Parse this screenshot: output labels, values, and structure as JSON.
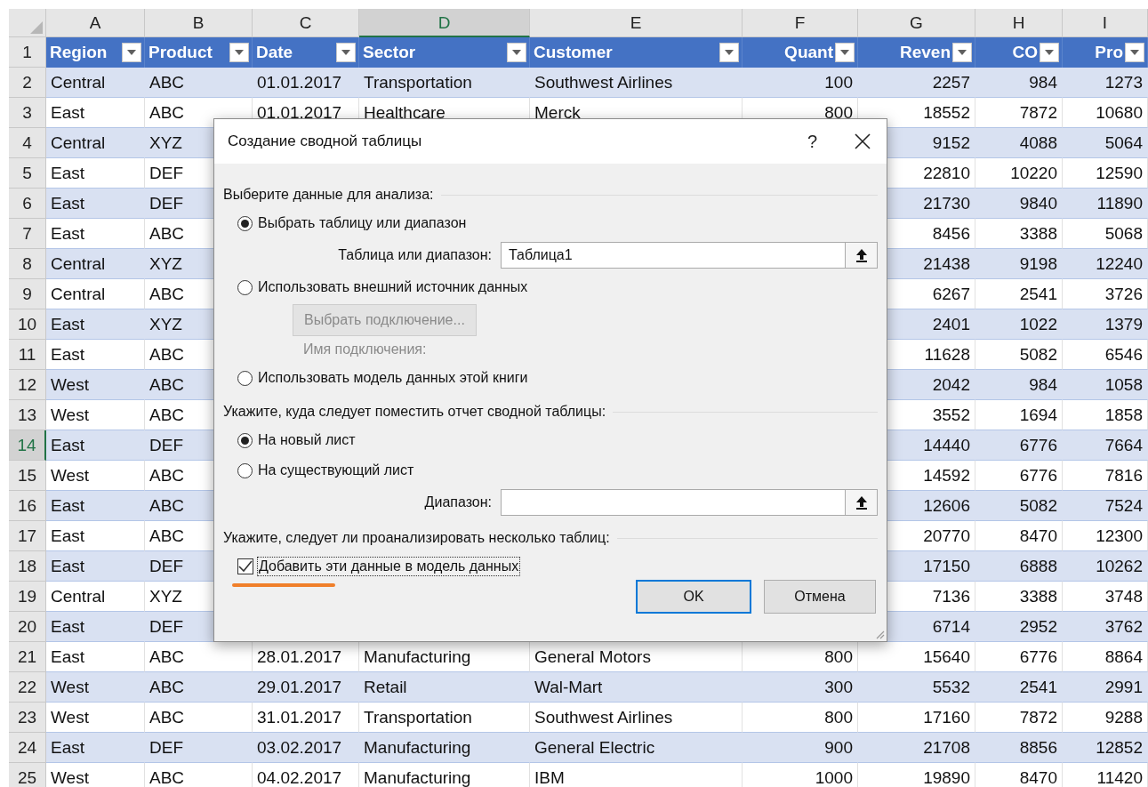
{
  "sheet": {
    "columns": [
      {
        "letter": "A",
        "header": "Region",
        "selected": false
      },
      {
        "letter": "B",
        "header": "Product",
        "selected": false
      },
      {
        "letter": "C",
        "header": "Date",
        "selected": false
      },
      {
        "letter": "D",
        "header": "Sector",
        "selected": true
      },
      {
        "letter": "E",
        "header": "Customer",
        "selected": false
      },
      {
        "letter": "F",
        "header": "Quant",
        "selected": false
      },
      {
        "letter": "G",
        "header": "Reven",
        "selected": false
      },
      {
        "letter": "H",
        "header": "CO",
        "selected": false
      },
      {
        "letter": "I",
        "header": "Pro",
        "selected": false
      }
    ],
    "header_row": "1",
    "rows": [
      {
        "number": "2",
        "selected": false,
        "cells": [
          "Central",
          "ABC",
          "01.01.2017",
          "Transportation",
          "Southwest Airlines",
          "100",
          "2257",
          "984",
          "1273"
        ]
      },
      {
        "number": "3",
        "selected": false,
        "cells": [
          "East",
          "ABC",
          "01.01.2017",
          "Healthcare",
          "Merck",
          "800",
          "18552",
          "7872",
          "10680"
        ]
      },
      {
        "number": "4",
        "selected": false,
        "cells": [
          "Central",
          "XYZ",
          null,
          null,
          null,
          null,
          "9152",
          "4088",
          "5064"
        ]
      },
      {
        "number": "5",
        "selected": false,
        "cells": [
          "East",
          "DEF",
          null,
          null,
          null,
          null,
          "22810",
          "10220",
          "12590"
        ]
      },
      {
        "number": "6",
        "selected": false,
        "cells": [
          "East",
          "DEF",
          null,
          null,
          null,
          null,
          "21730",
          "9840",
          "11890"
        ]
      },
      {
        "number": "7",
        "selected": false,
        "cells": [
          "East",
          "ABC",
          null,
          null,
          null,
          null,
          "8456",
          "3388",
          "5068"
        ]
      },
      {
        "number": "8",
        "selected": false,
        "cells": [
          "Central",
          "XYZ",
          null,
          null,
          null,
          null,
          "21438",
          "9198",
          "12240"
        ]
      },
      {
        "number": "9",
        "selected": false,
        "cells": [
          "Central",
          "ABC",
          null,
          null,
          null,
          null,
          "6267",
          "2541",
          "3726"
        ]
      },
      {
        "number": "10",
        "selected": false,
        "cells": [
          "East",
          "XYZ",
          null,
          null,
          null,
          null,
          "2401",
          "1022",
          "1379"
        ]
      },
      {
        "number": "11",
        "selected": false,
        "cells": [
          "East",
          "ABC",
          null,
          null,
          null,
          null,
          "11628",
          "5082",
          "6546"
        ]
      },
      {
        "number": "12",
        "selected": false,
        "cells": [
          "West",
          "ABC",
          null,
          null,
          null,
          null,
          "2042",
          "984",
          "1058"
        ]
      },
      {
        "number": "13",
        "selected": false,
        "cells": [
          "West",
          "ABC",
          null,
          null,
          null,
          null,
          "3552",
          "1694",
          "1858"
        ]
      },
      {
        "number": "14",
        "selected": true,
        "cells": [
          "East",
          "DEF",
          null,
          null,
          null,
          null,
          "14440",
          "6776",
          "7664"
        ]
      },
      {
        "number": "15",
        "selected": false,
        "cells": [
          "West",
          "ABC",
          null,
          null,
          null,
          null,
          "14592",
          "6776",
          "7816"
        ]
      },
      {
        "number": "16",
        "selected": false,
        "cells": [
          "East",
          "ABC",
          null,
          null,
          null,
          null,
          "12606",
          "5082",
          "7524"
        ]
      },
      {
        "number": "17",
        "selected": false,
        "cells": [
          "East",
          "ABC",
          null,
          null,
          null,
          null,
          "20770",
          "8470",
          "12300"
        ]
      },
      {
        "number": "18",
        "selected": false,
        "cells": [
          "East",
          "DEF",
          null,
          null,
          null,
          null,
          "17150",
          "6888",
          "10262"
        ]
      },
      {
        "number": "19",
        "selected": false,
        "cells": [
          "Central",
          "XYZ",
          null,
          null,
          null,
          null,
          "7136",
          "3388",
          "3748"
        ]
      },
      {
        "number": "20",
        "selected": false,
        "cells": [
          "East",
          "DEF",
          null,
          null,
          null,
          null,
          "6714",
          "2952",
          "3762"
        ]
      },
      {
        "number": "21",
        "selected": false,
        "cells": [
          "East",
          "ABC",
          "28.01.2017",
          "Manufacturing",
          "General Motors",
          "800",
          "15640",
          "6776",
          "8864"
        ]
      },
      {
        "number": "22",
        "selected": false,
        "cells": [
          "West",
          "ABC",
          "29.01.2017",
          "Retail",
          "Wal-Mart",
          "300",
          "5532",
          "2541",
          "2991"
        ]
      },
      {
        "number": "23",
        "selected": false,
        "cells": [
          "West",
          "ABC",
          "31.01.2017",
          "Transportation",
          "Southwest Airlines",
          "800",
          "17160",
          "7872",
          "9288"
        ]
      },
      {
        "number": "24",
        "selected": false,
        "cells": [
          "East",
          "DEF",
          "03.02.2017",
          "Manufacturing",
          "General Electric",
          "900",
          "21708",
          "8856",
          "12852"
        ]
      },
      {
        "number": "25",
        "selected": false,
        "cells": [
          "West",
          "ABC",
          "04.02.2017",
          "Manufacturing",
          "IBM",
          "1000",
          "19890",
          "8470",
          "11420"
        ]
      }
    ]
  },
  "dialog": {
    "title": "Создание сводной таблицы",
    "help": "?",
    "sections": [
      {
        "heading": "Выберите данные для анализа:",
        "items": [
          {
            "kind": "radio",
            "label": "Выбрать таблицу или диапазон",
            "selected": true
          },
          {
            "kind": "field",
            "label": "Таблица или диапазон:",
            "value": "Таблица1"
          },
          {
            "kind": "radio",
            "label": "Использовать внешний источник данных",
            "selected": false
          },
          {
            "kind": "button",
            "label": "Выбрать подключение...",
            "disabled": true
          },
          {
            "kind": "label",
            "label": "Имя подключения:",
            "disabled": true
          },
          {
            "kind": "radio",
            "label": "Использовать модель данных этой книги",
            "selected": false
          }
        ]
      },
      {
        "heading": "Укажите, куда следует поместить отчет сводной таблицы:",
        "items": [
          {
            "kind": "radio",
            "label": "На новый лист",
            "selected": true
          },
          {
            "kind": "radio",
            "label": "На существующий лист",
            "selected": false
          },
          {
            "kind": "field",
            "label": "Диапазон:"
          }
        ]
      },
      {
        "heading": "Укажите, следует ли проанализировать несколько таблиц:",
        "items": [
          {
            "kind": "checkbox",
            "label": "Добавить эти данные в модель данных",
            "checked": true,
            "focused": true
          }
        ]
      }
    ],
    "buttons": [
      {
        "label": "OK",
        "default": true
      },
      {
        "label": "Отмена",
        "default": false
      }
    ]
  }
}
